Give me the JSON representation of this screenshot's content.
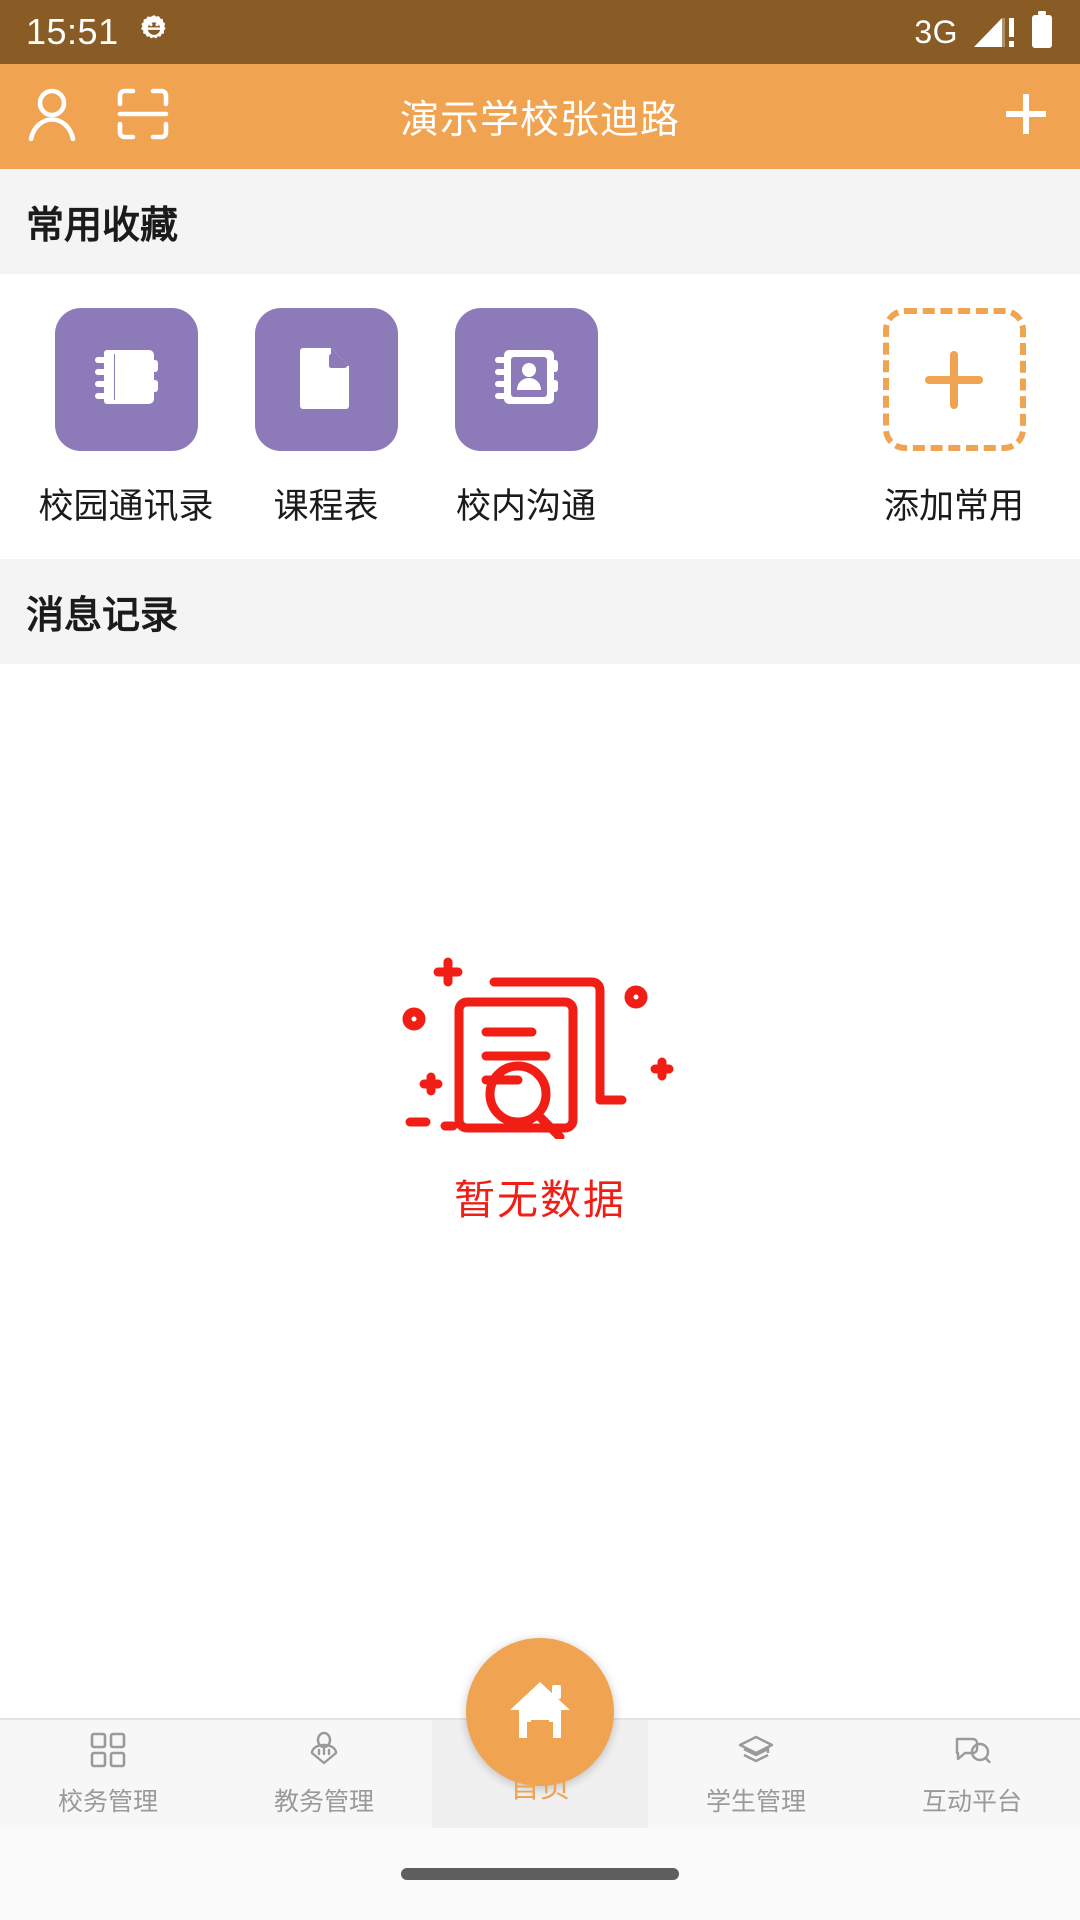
{
  "status_bar": {
    "time": "15:51",
    "settings_icon": "gear-icon",
    "network_label": "3G",
    "signal_icon": "signal-warning-icon",
    "battery_icon": "battery-full-icon",
    "bg_color": "#8A5C25"
  },
  "app_bar": {
    "title": "演示学校张迪路",
    "profile_icon": "person-icon",
    "scan_icon": "scan-icon",
    "add_icon": "plus-icon",
    "bg_color": "#F0A350"
  },
  "favorites_section": {
    "header": "常用收藏",
    "tile_color": "#8D7AB8",
    "items": [
      {
        "label": "校园通讯录",
        "icon": "notebook-icon"
      },
      {
        "label": "课程表",
        "icon": "document-icon"
      },
      {
        "label": "校内沟通",
        "icon": "address-book-icon"
      }
    ],
    "add_button": {
      "label": "添加常用",
      "icon": "dashed-plus-icon",
      "color": "#F0A350"
    }
  },
  "messages_section": {
    "header": "消息记录",
    "empty_state": {
      "text": "暂无数据",
      "color": "#F01E14",
      "illustration": "no-data-document-search-icon"
    }
  },
  "bottom_nav": {
    "active_color": "#F0A350",
    "inactive_color": "#9a9a9a",
    "tabs": [
      {
        "label": "校务管理",
        "icon": "grid-icon",
        "active": false
      },
      {
        "label": "教务管理",
        "icon": "teacher-icon",
        "active": false
      },
      {
        "label": "首页",
        "icon": "home-icon",
        "active": true
      },
      {
        "label": "学生管理",
        "icon": "graduation-cap-icon",
        "active": false
      },
      {
        "label": "互动平台",
        "icon": "chat-bubbles-icon",
        "active": false
      }
    ]
  },
  "gesture_bar": {
    "icon": "home-indicator"
  }
}
